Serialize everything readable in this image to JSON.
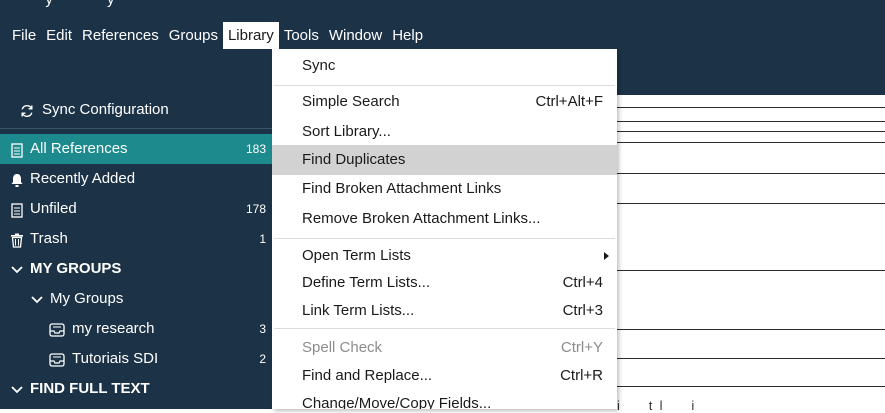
{
  "title_fragment": "        y             y",
  "menubar": {
    "items": [
      "File",
      "Edit",
      "References",
      "Groups",
      "Library",
      "Tools",
      "Window",
      "Help"
    ],
    "active": "Library"
  },
  "sidebar": {
    "sync": {
      "label": "Sync Configuration",
      "icon": "sync-icon"
    },
    "items": [
      {
        "label": "All References",
        "count": "183",
        "icon": "document-icon",
        "selected": true
      },
      {
        "label": "Recently Added",
        "count": "",
        "icon": "bell-icon"
      },
      {
        "label": "Unfiled",
        "count": "178",
        "icon": "document-icon"
      },
      {
        "label": "Trash",
        "count": "1",
        "icon": "trash-icon"
      },
      {
        "label": "MY GROUPS",
        "count": "",
        "icon": "chevron-down-icon"
      },
      {
        "label": "My Groups",
        "count": "",
        "icon": "chevron-down-icon"
      },
      {
        "label": "my research",
        "count": "3",
        "icon": "group-icon"
      },
      {
        "label": "Tutoriais SDI",
        "count": "2",
        "icon": "group-icon"
      },
      {
        "label": "FIND FULL TEXT",
        "count": "",
        "icon": "chevron-down-icon"
      }
    ]
  },
  "library_menu": {
    "items": [
      {
        "label": "Sync",
        "shortcut": ""
      },
      {
        "label": "Simple Search",
        "shortcut": "Ctrl+Alt+F"
      },
      {
        "label": "Sort Library...",
        "shortcut": ""
      },
      {
        "label": "Find Duplicates",
        "shortcut": "",
        "highlighted": true
      },
      {
        "label": "Find Broken Attachment Links",
        "shortcut": ""
      },
      {
        "label": "Remove Broken Attachment Links...",
        "shortcut": ""
      },
      {
        "label": "Open Term Lists",
        "shortcut": "",
        "submenu": true
      },
      {
        "label": "Define Term Lists...",
        "shortcut": "Ctrl+4"
      },
      {
        "label": "Link Term Lists...",
        "shortcut": "Ctrl+3"
      },
      {
        "label": "Spell Check",
        "shortcut": "Ctrl+Y",
        "disabled": true
      },
      {
        "label": "Find and Replace...",
        "shortcut": "Ctrl+R"
      },
      {
        "label": "Change/Move/Copy Fields...",
        "shortcut": ""
      }
    ]
  },
  "main": {
    "tail_text": "i        t  l        i"
  },
  "colors": {
    "chrome": "#1c3347",
    "selected": "#1d8a8e",
    "menu_highlight": "#d2d2d2",
    "disabled_text": "#8c8c8c"
  }
}
